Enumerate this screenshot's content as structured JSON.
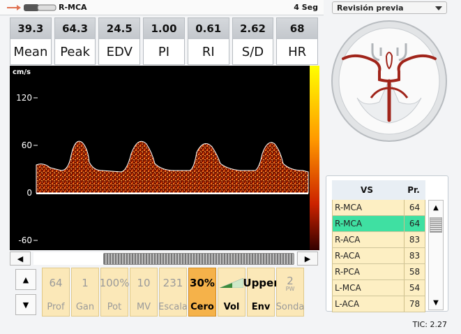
{
  "header": {
    "vessel": "R-MCA",
    "time_window": "4 Seg"
  },
  "metrics": [
    {
      "value": "39.3",
      "label": "Mean"
    },
    {
      "value": "64.3",
      "label": "Peak"
    },
    {
      "value": "24.5",
      "label": "EDV"
    },
    {
      "value": "1.00",
      "label": "PI"
    },
    {
      "value": "0.61",
      "label": "RI"
    },
    {
      "value": "2.62",
      "label": "S/D"
    },
    {
      "value": "68",
      "label": "HR"
    }
  ],
  "spectrum": {
    "unit": "cm/s",
    "ticks": [
      "120",
      "60",
      "0",
      "-60"
    ],
    "colors": {
      "baseline": "#ffffff",
      "signal_high": "#ffff00",
      "signal_low": "#8b1a00"
    }
  },
  "controls": [
    {
      "value": "64",
      "label": "Prof"
    },
    {
      "value": "1",
      "label": "Gan"
    },
    {
      "value": "100%",
      "label": "Pot"
    },
    {
      "value": "10",
      "label": "MV"
    },
    {
      "value": "231",
      "label": "Escala"
    },
    {
      "value": "30%",
      "label": "Cero",
      "active": true
    },
    {
      "value": "",
      "label": "Vol",
      "icon": "volume-ramp-icon"
    },
    {
      "value": "Upper",
      "label": "Env"
    },
    {
      "value": "2",
      "sub": "PW",
      "label": "Sonda"
    }
  ],
  "preview": {
    "selected": "Revisión previa"
  },
  "vessel_table": {
    "headers": [
      "VS",
      "Pr."
    ],
    "rows": [
      {
        "vs": "R-MCA",
        "pr": "64",
        "selected": false
      },
      {
        "vs": "R-MCA",
        "pr": "64",
        "selected": true
      },
      {
        "vs": "R-ACA",
        "pr": "83",
        "selected": false
      },
      {
        "vs": "R-ACA",
        "pr": "83",
        "selected": false
      },
      {
        "vs": "R-PCA",
        "pr": "58",
        "selected": false
      },
      {
        "vs": "L-MCA",
        "pr": "54",
        "selected": false
      },
      {
        "vs": "L-ACA",
        "pr": "78",
        "selected": false
      }
    ]
  },
  "footer": {
    "tic": "TIC: 2.27"
  }
}
